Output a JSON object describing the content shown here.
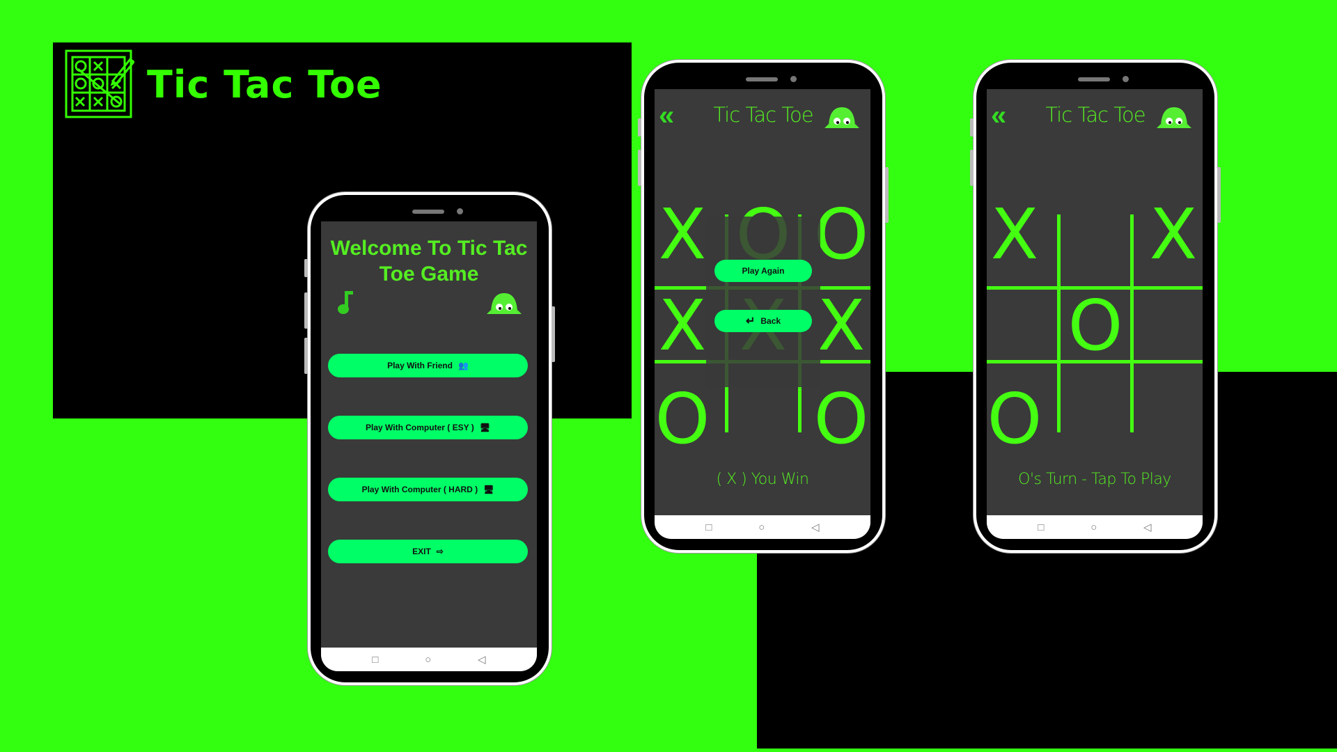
{
  "colors": {
    "background": "#33ff11",
    "accent": "#00ff66",
    "text_green": "#55ee22",
    "screen": "#3a3a3a"
  },
  "banner": {
    "title": "Tic Tac Toe",
    "logo_icon": "tic-tac-toe-board-with-pencil"
  },
  "menu_phone": {
    "welcome_line1": "Welcome To Tic Tac",
    "welcome_line2": "Toe Game",
    "buttons": [
      {
        "label": "Play With Friend",
        "icon": "people-icon"
      },
      {
        "label": "Play With Computer ( ESY )",
        "icon": "monitor-icon"
      },
      {
        "label": "Play With Computer ( HARD )",
        "icon": "monitor-icon"
      },
      {
        "label": "EXIT",
        "icon": "exit-icon"
      }
    ]
  },
  "game_win": {
    "title": "Tic Tac Toe",
    "board": [
      "X",
      "O",
      "O",
      "X",
      "X",
      "X",
      "O",
      "",
      "O"
    ],
    "play_again": "Play Again",
    "back": "Back",
    "status": "( X ) You Win"
  },
  "game_turn": {
    "title": "Tic Tac Toe",
    "board": [
      "X",
      "",
      "X",
      "",
      "O",
      "",
      "O",
      "",
      ""
    ],
    "status": "O's Turn - Tap To Play"
  },
  "nav": {
    "recent": "□",
    "home": "○",
    "back": "◁"
  },
  "glyphs": {
    "chevrons": "«",
    "music": "♪"
  }
}
